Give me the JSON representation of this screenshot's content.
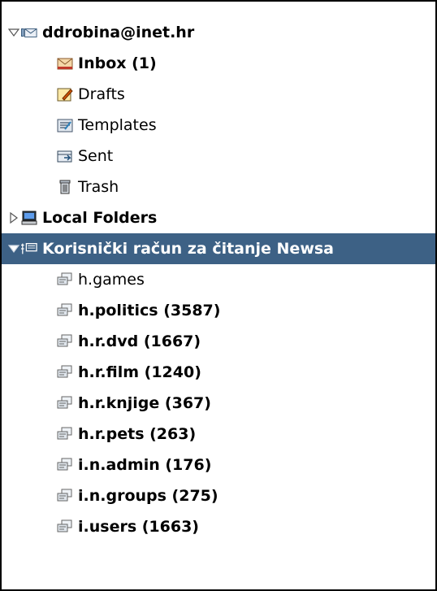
{
  "accounts": [
    {
      "name": "ddrobina@inet.hr",
      "expanded": true,
      "folders": [
        {
          "label": "Inbox (1)",
          "icon": "inbox-icon",
          "bold": true
        },
        {
          "label": "Drafts",
          "icon": "drafts-icon",
          "bold": false
        },
        {
          "label": "Templates",
          "icon": "templates-icon",
          "bold": false
        },
        {
          "label": "Sent",
          "icon": "sent-icon",
          "bold": false
        },
        {
          "label": "Trash",
          "icon": "trash-icon",
          "bold": false
        }
      ]
    },
    {
      "name": "Local Folders",
      "expanded": false
    },
    {
      "name": "Korisnički račun za čitanje Newsa",
      "expanded": true,
      "selected": true,
      "newsgroups": [
        {
          "label": "h.games",
          "bold": false
        },
        {
          "label": "h.politics (3587)",
          "bold": true
        },
        {
          "label": "h.r.dvd (1667)",
          "bold": true
        },
        {
          "label": "h.r.film (1240)",
          "bold": true
        },
        {
          "label": "h.r.knjige (367)",
          "bold": true
        },
        {
          "label": "h.r.pets (263)",
          "bold": true
        },
        {
          "label": "i.n.admin (176)",
          "bold": true
        },
        {
          "label": "i.n.groups (275)",
          "bold": true
        },
        {
          "label": "i.users (1663)",
          "bold": true
        }
      ]
    }
  ],
  "colors": {
    "selection": "#3d6185",
    "border": "#000000"
  }
}
